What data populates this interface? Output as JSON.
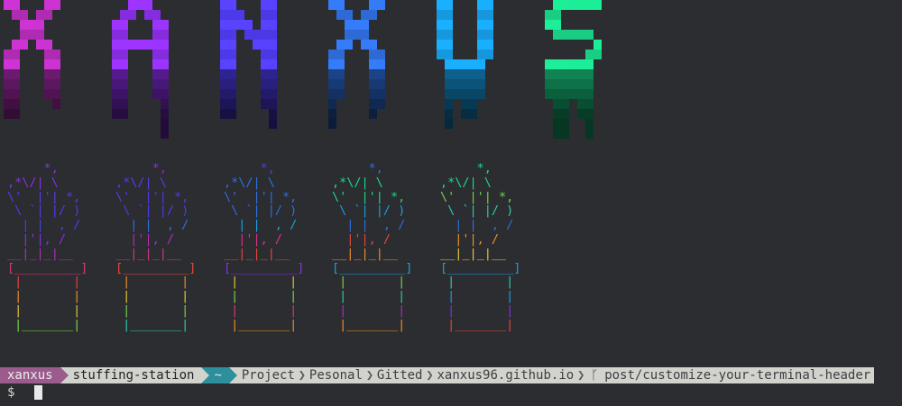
{
  "banner": {
    "text": "XANXUS",
    "colors": [
      "#b32db8",
      "#8a2ee6",
      "#4f3bf0",
      "#2f6fe0",
      "#179fe8",
      "#1ad98a"
    ]
  },
  "plants": {
    "lines": [
      "     *,",
      ",*\\/| \\",
      "\\'  |'| *,",
      " \\ `| |/ )",
      "  | |  , /",
      "  |'|, /",
      "__|_|_|__",
      "[_________]",
      " |       |",
      " |       |",
      " |       |",
      " |_______|"
    ],
    "palettes": [
      [
        "#8a2ee6",
        "#8a2ee6",
        "#5a3aee",
        "#4f3bf0",
        "#4f3bf0",
        "#8a2ee6",
        "#b32db8",
        "#e0357e",
        "#e8453a",
        "#ef8f28",
        "#e9c832",
        "#79d44a"
      ],
      [
        "#8a2ee6",
        "#5a3aee",
        "#4f3bf0",
        "#4f3bf0",
        "#2f6fe0",
        "#b32db8",
        "#d63585",
        "#e8453a",
        "#ef8f28",
        "#e9c832",
        "#79d44a",
        "#34c7b0"
      ],
      [
        "#4f3bf0",
        "#2f6fe0",
        "#2f6fe0",
        "#2f6fe0",
        "#179fe8",
        "#d63585",
        "#e8453a",
        "#8a2ee6",
        "#e9c832",
        "#79d44a",
        "#e0357e",
        "#ef8f28"
      ],
      [
        "#2f6fe0",
        "#1ad98a",
        "#1ad98a",
        "#179fe8",
        "#2f6fe0",
        "#e8453a",
        "#ef8f28",
        "#179fe8",
        "#79d44a",
        "#34c7b0",
        "#b32db8",
        "#ef8f28"
      ],
      [
        "#1ad98a",
        "#1ad98a",
        "#79d44a",
        "#34c7b0",
        "#2f6fe0",
        "#ef8f28",
        "#e9c832",
        "#179fe8",
        "#34c7b0",
        "#179fe8",
        "#8a2ee6",
        "#e8453a"
      ]
    ]
  },
  "statusbar": {
    "user": "xanxus",
    "host": "stuffing-station",
    "home": "~",
    "path": [
      "Project",
      "Pesonal",
      "Gitted",
      "xanxus96.github.io"
    ],
    "git_icon": "git-branch-icon",
    "branch": "post/customize-your-terminal-header"
  },
  "prompt": {
    "symbol": "$"
  }
}
